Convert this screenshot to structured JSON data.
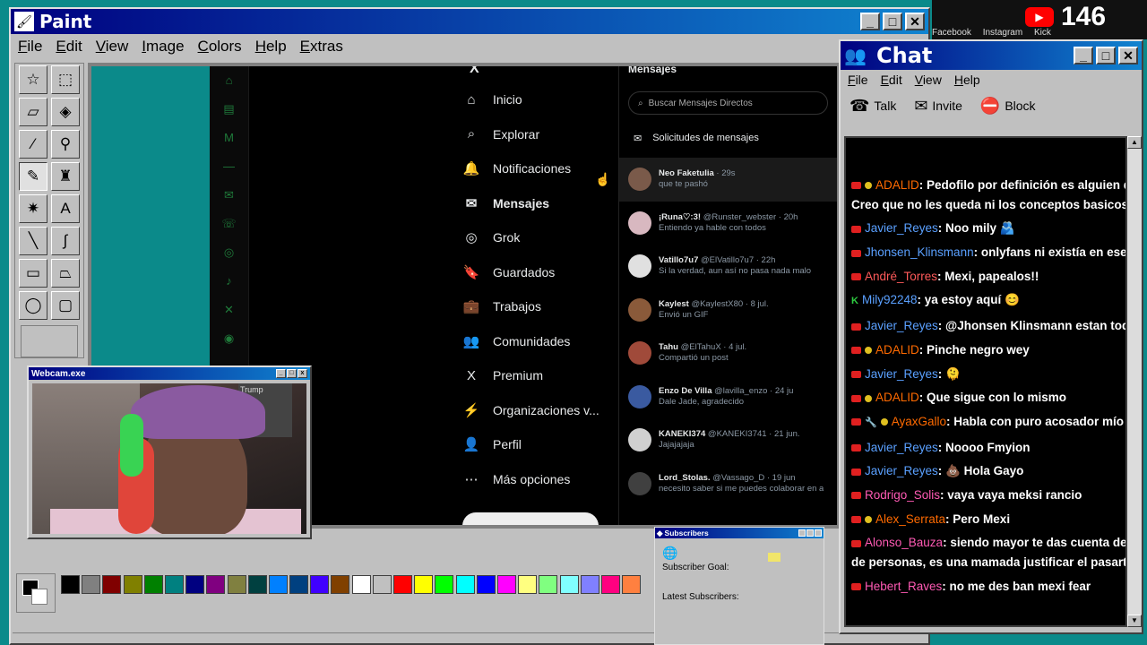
{
  "paint": {
    "title": "Paint",
    "menu": [
      "File",
      "Edit",
      "View",
      "Image",
      "Colors",
      "Help",
      "Extras"
    ],
    "palette": [
      "#000000",
      "#808080",
      "#800000",
      "#808000",
      "#008000",
      "#008080",
      "#000080",
      "#800080",
      "#808040",
      "#004040",
      "#0080ff",
      "#004080",
      "#4000ff",
      "#804000",
      "#ffffff",
      "#c0c0c0",
      "#ff0000",
      "#ffff00",
      "#00ff00",
      "#00ffff",
      "#0000ff",
      "#ff00ff",
      "#ffff80",
      "#80ff80",
      "#80ffff",
      "#8080ff",
      "#ff0080",
      "#ff8040"
    ]
  },
  "x_screen": {
    "logo": "X",
    "nav": [
      {
        "icon": "⌂",
        "label": "Inicio"
      },
      {
        "icon": "⌕",
        "label": "Explorar"
      },
      {
        "icon": "🔔",
        "label": "Notificaciones"
      },
      {
        "icon": "✉",
        "label": "Mensajes"
      },
      {
        "icon": "◎",
        "label": "Grok"
      },
      {
        "icon": "🔖",
        "label": "Guardados"
      },
      {
        "icon": "💼",
        "label": "Trabajos"
      },
      {
        "icon": "👥",
        "label": "Comunidades"
      },
      {
        "icon": "X",
        "label": "Premium"
      },
      {
        "icon": "⚡",
        "label": "Organizaciones v..."
      },
      {
        "icon": "👤",
        "label": "Perfil"
      },
      {
        "icon": "⋯",
        "label": "Más opciones"
      }
    ],
    "messages_header": "Mensajes",
    "search_placeholder": "Buscar Mensajes Directos",
    "requests": "Solicitudes de mensajes",
    "dms": [
      {
        "name": "Neo Faketulia",
        "meta": "· 29s",
        "preview": "que te pashó"
      },
      {
        "name": "¡Runa♡:3!",
        "meta": "@Runster_webster · 20h",
        "preview": "Entiendo ya hable con todos"
      },
      {
        "name": "Vatillo7u7",
        "meta": "@ElVatillo7u7 · 22h",
        "preview": "Si la verdad, aun así no pasa nada malo"
      },
      {
        "name": "Kaylest",
        "meta": "@KaylestX80 · 8 jul.",
        "preview": "Envió un GIF"
      },
      {
        "name": "Tahu",
        "meta": "@ElTahuX · 4 jul.",
        "preview": "Compartió un post"
      },
      {
        "name": "Enzo De Villa",
        "meta": "@lavilla_enzo · 24 ju",
        "preview": "Dale Jade, agradecido"
      },
      {
        "name": "KANEKI374",
        "meta": "@KANEKI3741 · 21 jun.",
        "preview": "Jajajajaja"
      },
      {
        "name": "Lord_Stolas.",
        "meta": "@Vassago_D · 19 jun",
        "preview": "necesito saber si me puedes colaborar en a"
      }
    ]
  },
  "webcam": {
    "title": "Webcam.exe",
    "poster_text": "Trump"
  },
  "subscribers": {
    "title": "Subscribers",
    "goal_label": "Subscriber Goal:",
    "latest_label": "Latest Subscribers:"
  },
  "chat": {
    "title": "Chat",
    "menu": [
      "File",
      "Edit",
      "View",
      "Help"
    ],
    "tools": [
      {
        "icon": "☎",
        "label": "Talk"
      },
      {
        "icon": "✉",
        "label": "Invite"
      },
      {
        "icon": "⛔",
        "label": "Block"
      }
    ],
    "messages": [
      {
        "badges": [
          "yt",
          "mod"
        ],
        "user": "ADALID",
        "color": "#ff6a00",
        "text": ": Pedofilo por definición es alguien q"
      },
      {
        "badges": [],
        "user": "",
        "color": "#ffffff",
        "text": "Creo que no les queda ni los conceptos basicos"
      },
      {
        "badges": [
          "yt"
        ],
        "user": "Javier_Reyes",
        "color": "#5aa0ff",
        "text": ": Noo mily 🫂"
      },
      {
        "badges": [
          "yt"
        ],
        "user": "Jhonsen_Klinsmann",
        "color": "#5aa0ff",
        "text": ": onlyfans ni existía en ese"
      },
      {
        "badges": [
          "yt"
        ],
        "user": "André_Torres",
        "color": "#ff5a5a",
        "text": ": Mexi, papealos!!"
      },
      {
        "badges": [
          "kick"
        ],
        "user": "Mily92248",
        "color": "#5aa0ff",
        "text": ": ya estoy aquí 😊"
      },
      {
        "badges": [
          "yt"
        ],
        "user": "Javier_Reyes",
        "color": "#5aa0ff",
        "text": ": @Jhonsen Klinsmann estan tod"
      },
      {
        "badges": [
          "yt",
          "mod"
        ],
        "user": "ADALID",
        "color": "#ff6a00",
        "text": ": Pinche negro wey"
      },
      {
        "badges": [
          "yt"
        ],
        "user": "Javier_Reyes",
        "color": "#5aa0ff",
        "text": ": 🫠"
      },
      {
        "badges": [
          "yt",
          "mod"
        ],
        "user": "ADALID",
        "color": "#ff6a00",
        "text": ": Que sigue con lo mismo"
      },
      {
        "badges": [
          "yt",
          "tool",
          "mod"
        ],
        "user": "AyaxGallo",
        "color": "#ff6a00",
        "text": ": Habla con puro acosador mío y"
      },
      {
        "badges": [
          "yt"
        ],
        "user": "Javier_Reyes",
        "color": "#5aa0ff",
        "text": ": Noooo Fmyion"
      },
      {
        "badges": [
          "yt"
        ],
        "user": "Javier_Reyes",
        "color": "#5aa0ff",
        "text": ": 💩 Hola Gayo"
      },
      {
        "badges": [
          "yt"
        ],
        "user": "Rodrigo_Solis",
        "color": "#ff5ab4",
        "text": ": vaya vaya meksi rancio"
      },
      {
        "badges": [
          "yt",
          "mod"
        ],
        "user": "Alex_Serrata",
        "color": "#ff6a00",
        "text": ": Pero Mexi"
      },
      {
        "badges": [
          "yt"
        ],
        "user": "Alonso_Bauza",
        "color": "#ff5ab4",
        "text": ": siendo mayor te das cuenta de"
      },
      {
        "badges": [],
        "user": "",
        "color": "#ffffff",
        "text": "de personas, es una mamada justificar el pasarte c"
      },
      {
        "badges": [
          "yt"
        ],
        "user": "Hebert_Raves",
        "color": "#ff5ab4",
        "text": ": no me des ban mexi fear"
      }
    ]
  },
  "overlay": {
    "yt_count": "146",
    "links": [
      "Facebook",
      "Instagram",
      "Kick"
    ]
  }
}
